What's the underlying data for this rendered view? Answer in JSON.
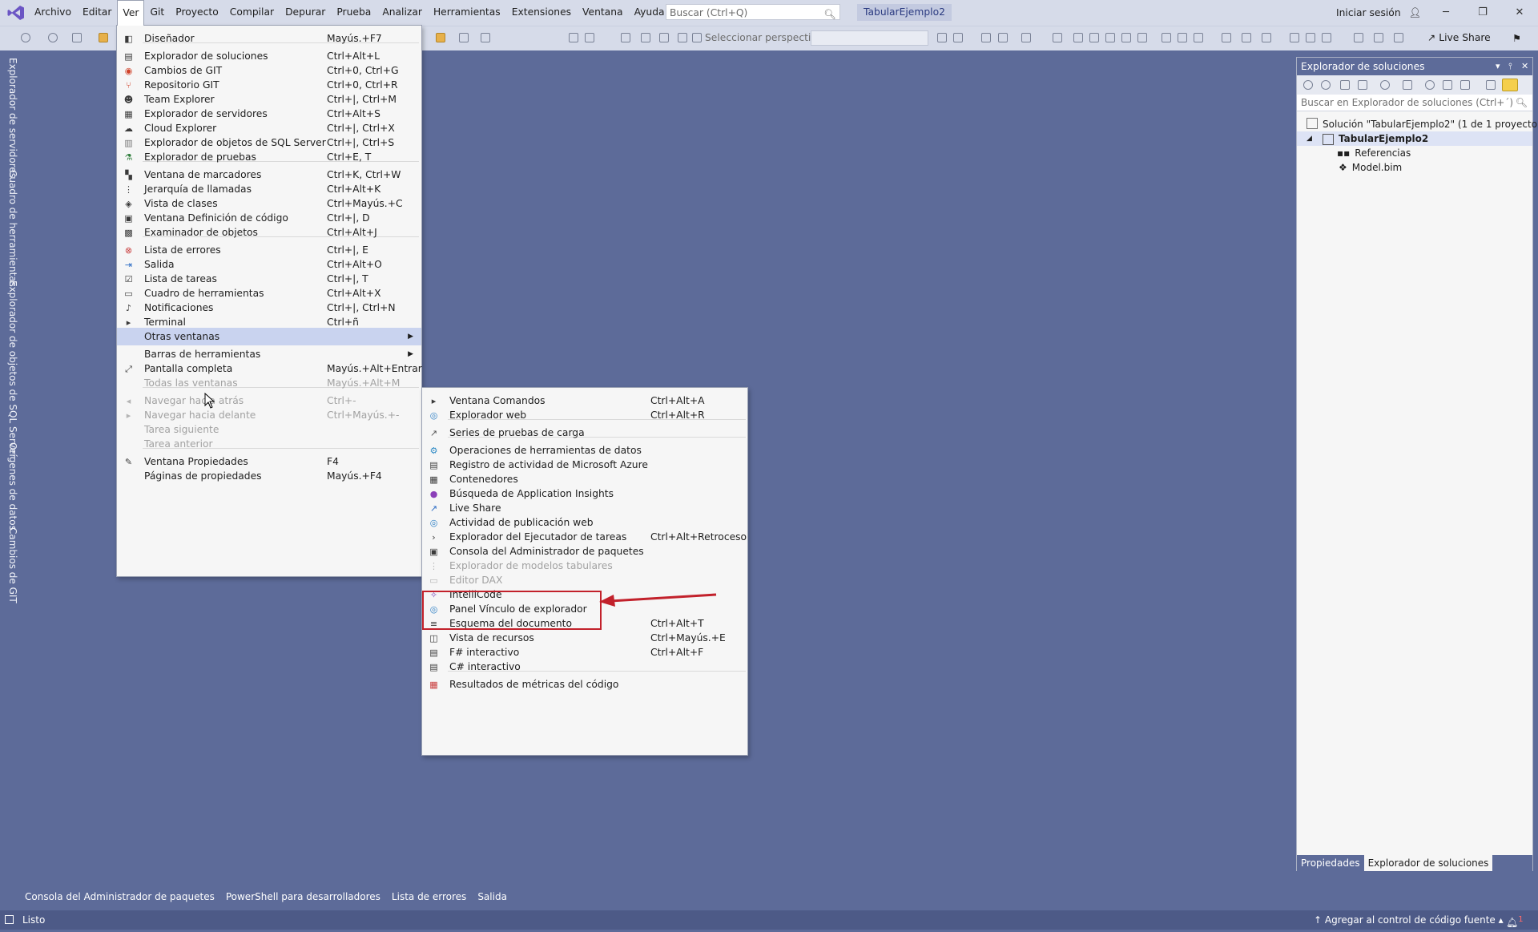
{
  "menubar": {
    "items": [
      "Archivo",
      "Editar",
      "Ver",
      "Git",
      "Proyecto",
      "Compilar",
      "Depurar",
      "Prueba",
      "Analizar",
      "Herramientas",
      "Extensiones",
      "Ventana",
      "Ayuda"
    ],
    "search_placeholder": "Buscar (Ctrl+Q)",
    "solution_name": "TabularEjemplo2",
    "signin": "Iniciar sesión"
  },
  "window_controls": {
    "minimize": "─",
    "restore": "❐",
    "close": "✕"
  },
  "toolbar": {
    "perspective_label": "Seleccionar perspectiva",
    "perspective_value": "",
    "liveshare": "Live Share"
  },
  "left_tabs": [
    "Explorador de servidores",
    "Cuadro de herramientas",
    "Explorador de objetos de SQL Server",
    "Orígenes de datos",
    "Cambios de GIT"
  ],
  "ver_menu": {
    "items": [
      {
        "label": "Diseñador",
        "shortcut": "Mayús.+F7",
        "icon": "designer-icon"
      },
      {
        "label": "Explorador de soluciones",
        "shortcut": "Ctrl+Alt+L",
        "icon": "solution-explorer-icon"
      },
      {
        "label": "Cambios de GIT",
        "shortcut": "Ctrl+0, Ctrl+G",
        "icon": "git-changes-icon"
      },
      {
        "label": "Repositorio GIT",
        "shortcut": "Ctrl+0, Ctrl+R",
        "icon": "git-repository-icon"
      },
      {
        "label": "Team Explorer",
        "shortcut": "Ctrl+|, Ctrl+M",
        "icon": "team-explorer-icon"
      },
      {
        "label": "Explorador de servidores",
        "shortcut": "Ctrl+Alt+S",
        "icon": "server-explorer-icon"
      },
      {
        "label": "Cloud Explorer",
        "shortcut": "Ctrl+|, Ctrl+X",
        "icon": "cloud-icon"
      },
      {
        "label": "Explorador de objetos de SQL Server",
        "shortcut": "Ctrl+|, Ctrl+S",
        "icon": "sql-server-icon"
      },
      {
        "label": "Explorador de pruebas",
        "shortcut": "Ctrl+E, T",
        "icon": "test-explorer-icon"
      },
      {
        "label": "Ventana de marcadores",
        "shortcut": "Ctrl+K, Ctrl+W",
        "icon": "bookmark-icon"
      },
      {
        "label": "Jerarquía de llamadas",
        "shortcut": "Ctrl+Alt+K",
        "icon": "call-hierarchy-icon"
      },
      {
        "label": "Vista de clases",
        "shortcut": "Ctrl+Mayús.+C",
        "icon": "class-view-icon"
      },
      {
        "label": "Ventana Definición de código",
        "shortcut": "Ctrl+|, D",
        "icon": "code-definition-icon"
      },
      {
        "label": "Examinador de objetos",
        "shortcut": "Ctrl+Alt+J",
        "icon": "object-browser-icon"
      },
      {
        "label": "Lista de errores",
        "shortcut": "Ctrl+|, E",
        "icon": "error-list-icon"
      },
      {
        "label": "Salida",
        "shortcut": "Ctrl+Alt+O",
        "icon": "output-icon"
      },
      {
        "label": "Lista de tareas",
        "shortcut": "Ctrl+|, T",
        "icon": "task-list-icon"
      },
      {
        "label": "Cuadro de herramientas",
        "shortcut": "Ctrl+Alt+X",
        "icon": "toolbox-icon"
      },
      {
        "label": "Notificaciones",
        "shortcut": "Ctrl+|, Ctrl+N",
        "icon": "bell-icon"
      },
      {
        "label": "Terminal",
        "shortcut": "Ctrl+ñ",
        "icon": "terminal-icon"
      },
      {
        "label": "Otras ventanas",
        "shortcut": "",
        "icon": ""
      },
      {
        "label": "Barras de herramientas",
        "shortcut": "",
        "icon": ""
      },
      {
        "label": "Pantalla completa",
        "shortcut": "Mayús.+Alt+Entrar",
        "icon": "fullscreen-icon"
      },
      {
        "label": "Todas las ventanas",
        "shortcut": "Mayús.+Alt+M",
        "icon": ""
      },
      {
        "label": "Navegar hacia atrás",
        "shortcut": "Ctrl+-",
        "icon": "nav-back-icon"
      },
      {
        "label": "Navegar hacia delante",
        "shortcut": "Ctrl+Mayús.+-",
        "icon": "nav-forward-icon"
      },
      {
        "label": "Tarea siguiente",
        "shortcut": "",
        "icon": ""
      },
      {
        "label": "Tarea anterior",
        "shortcut": "",
        "icon": ""
      },
      {
        "label": "Ventana Propiedades",
        "shortcut": "F4",
        "icon": "wrench-icon"
      },
      {
        "label": "Páginas de propiedades",
        "shortcut": "Mayús.+F4",
        "icon": ""
      }
    ]
  },
  "sub_menu": {
    "items": [
      {
        "label": "Ventana Comandos",
        "shortcut": "Ctrl+Alt+A",
        "icon": "command-window-icon"
      },
      {
        "label": "Explorador web",
        "shortcut": "Ctrl+Alt+R",
        "icon": "web-browser-icon"
      },
      {
        "label": "Series de pruebas de carga",
        "shortcut": "",
        "icon": "load-test-icon"
      },
      {
        "label": "Operaciones de herramientas de datos",
        "shortcut": "",
        "icon": "data-tools-icon"
      },
      {
        "label": "Registro de actividad de Microsoft Azure",
        "shortcut": "",
        "icon": "azure-log-icon"
      },
      {
        "label": "Contenedores",
        "shortcut": "",
        "icon": "containers-icon"
      },
      {
        "label": "Búsqueda de Application Insights",
        "shortcut": "",
        "icon": "app-insights-icon"
      },
      {
        "label": "Live Share",
        "shortcut": "",
        "icon": "live-share-icon"
      },
      {
        "label": "Actividad de publicación web",
        "shortcut": "",
        "icon": "web-publish-icon"
      },
      {
        "label": "Explorador del Ejecutador de tareas",
        "shortcut": "Ctrl+Alt+Retroceso",
        "icon": "task-runner-icon"
      },
      {
        "label": "Consola del Administrador de paquetes",
        "shortcut": "",
        "icon": "package-console-icon"
      },
      {
        "label": "Explorador de modelos tabulares",
        "shortcut": "",
        "icon": "tabular-model-icon"
      },
      {
        "label": "Editor DAX",
        "shortcut": "",
        "icon": "dax-editor-icon"
      },
      {
        "label": "IntelliCode",
        "shortcut": "",
        "icon": "intellicode-icon"
      },
      {
        "label": "Panel Vínculo de explorador",
        "shortcut": "",
        "icon": "browser-link-icon"
      },
      {
        "label": "Esquema del documento",
        "shortcut": "Ctrl+Alt+T",
        "icon": "document-outline-icon"
      },
      {
        "label": "Vista de recursos",
        "shortcut": "Ctrl+Mayús.+E",
        "icon": "resource-view-icon"
      },
      {
        "label": "F# interactivo",
        "shortcut": "Ctrl+Alt+F",
        "icon": "fsharp-icon"
      },
      {
        "label": "C# interactivo",
        "shortcut": "",
        "icon": "csharp-icon"
      },
      {
        "label": "Resultados de métricas del código",
        "shortcut": "",
        "icon": "code-metrics-icon"
      }
    ]
  },
  "solution_explorer": {
    "title": "Explorador de soluciones",
    "search_placeholder": "Buscar en Explorador de soluciones (Ctrl+´)",
    "solution_node": "Solución \"TabularEjemplo2\" (1 de 1 proyecto)",
    "project_node": "TabularEjemplo2",
    "references_node": "Referencias",
    "model_node": "Model.bim",
    "tab_properties": "Propiedades",
    "tab_solution": "Explorador de soluciones"
  },
  "bottom_tabs": [
    "Consola del Administrador de paquetes",
    "PowerShell para desarrolladores",
    "Lista de errores",
    "Salida"
  ],
  "status": {
    "ready": "Listo",
    "source_control": "Agregar al control de código fuente",
    "notifications_count": "1"
  },
  "colors": {
    "accent": "#5d6b99",
    "highlight": "#c2212b",
    "chrome": "#d6dbe9",
    "status": "#4d5a87"
  }
}
